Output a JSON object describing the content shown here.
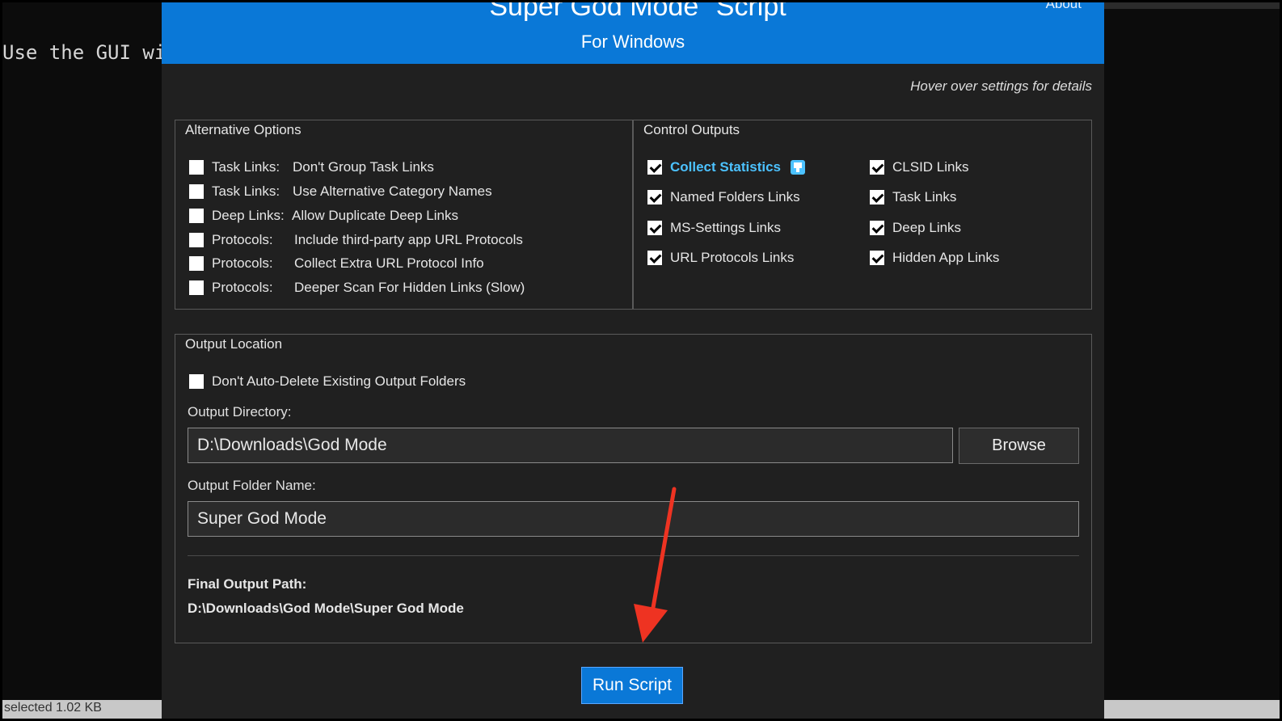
{
  "console": {
    "text": "Use the GUI wir",
    "status": "selected  1.02 KB"
  },
  "header": {
    "title": "\"Super God Mode\" Script",
    "subtitle": "For Windows",
    "about": "About"
  },
  "hint": "Hover over settings for details",
  "alternative_options": {
    "title": "Alternative Options",
    "items": [
      {
        "prefix": "Task Links:",
        "label": "Don't Group Task Links",
        "checked": false
      },
      {
        "prefix": "Task Links:",
        "label": "Use Alternative Category Names",
        "checked": false
      },
      {
        "prefix": "Deep Links:",
        "label": "Allow Duplicate Deep Links",
        "checked": false
      },
      {
        "prefix": "Protocols:",
        "label": "Include third-party app URL Protocols",
        "checked": false
      },
      {
        "prefix": "Protocols:",
        "label": "Collect Extra URL Protocol Info",
        "checked": false
      },
      {
        "prefix": "Protocols:",
        "label": "Deeper Scan For Hidden Links (Slow)",
        "checked": false
      }
    ]
  },
  "control_outputs": {
    "title": "Control Outputs",
    "left": [
      {
        "label": "Collect Statistics",
        "checked": true
      },
      {
        "label": "Named Folders Links",
        "checked": true
      },
      {
        "label": "MS-Settings Links",
        "checked": true
      },
      {
        "label": "URL Protocols Links",
        "checked": true
      }
    ],
    "right": [
      {
        "label": "CLSID Links",
        "checked": true
      },
      {
        "label": "Task Links",
        "checked": true
      },
      {
        "label": "Deep Links",
        "checked": true
      },
      {
        "label": "Hidden App Links",
        "checked": true
      }
    ]
  },
  "output_location": {
    "title": "Output Location",
    "no_delete_label": "Don't Auto-Delete Existing Output Folders",
    "directory_label": "Output Directory:",
    "directory_value": "D:\\Downloads\\God Mode",
    "browse_label": "Browse",
    "folder_label": "Output Folder Name:",
    "folder_value": "Super God Mode",
    "final_label": "Final Output Path:",
    "final_path": "D:\\Downloads\\God Mode\\Super God Mode"
  },
  "run_label": "Run Script",
  "colors": {
    "accent": "#0a78d7",
    "stat_highlight": "#4cc2ff",
    "arrow": "#ee3322"
  }
}
